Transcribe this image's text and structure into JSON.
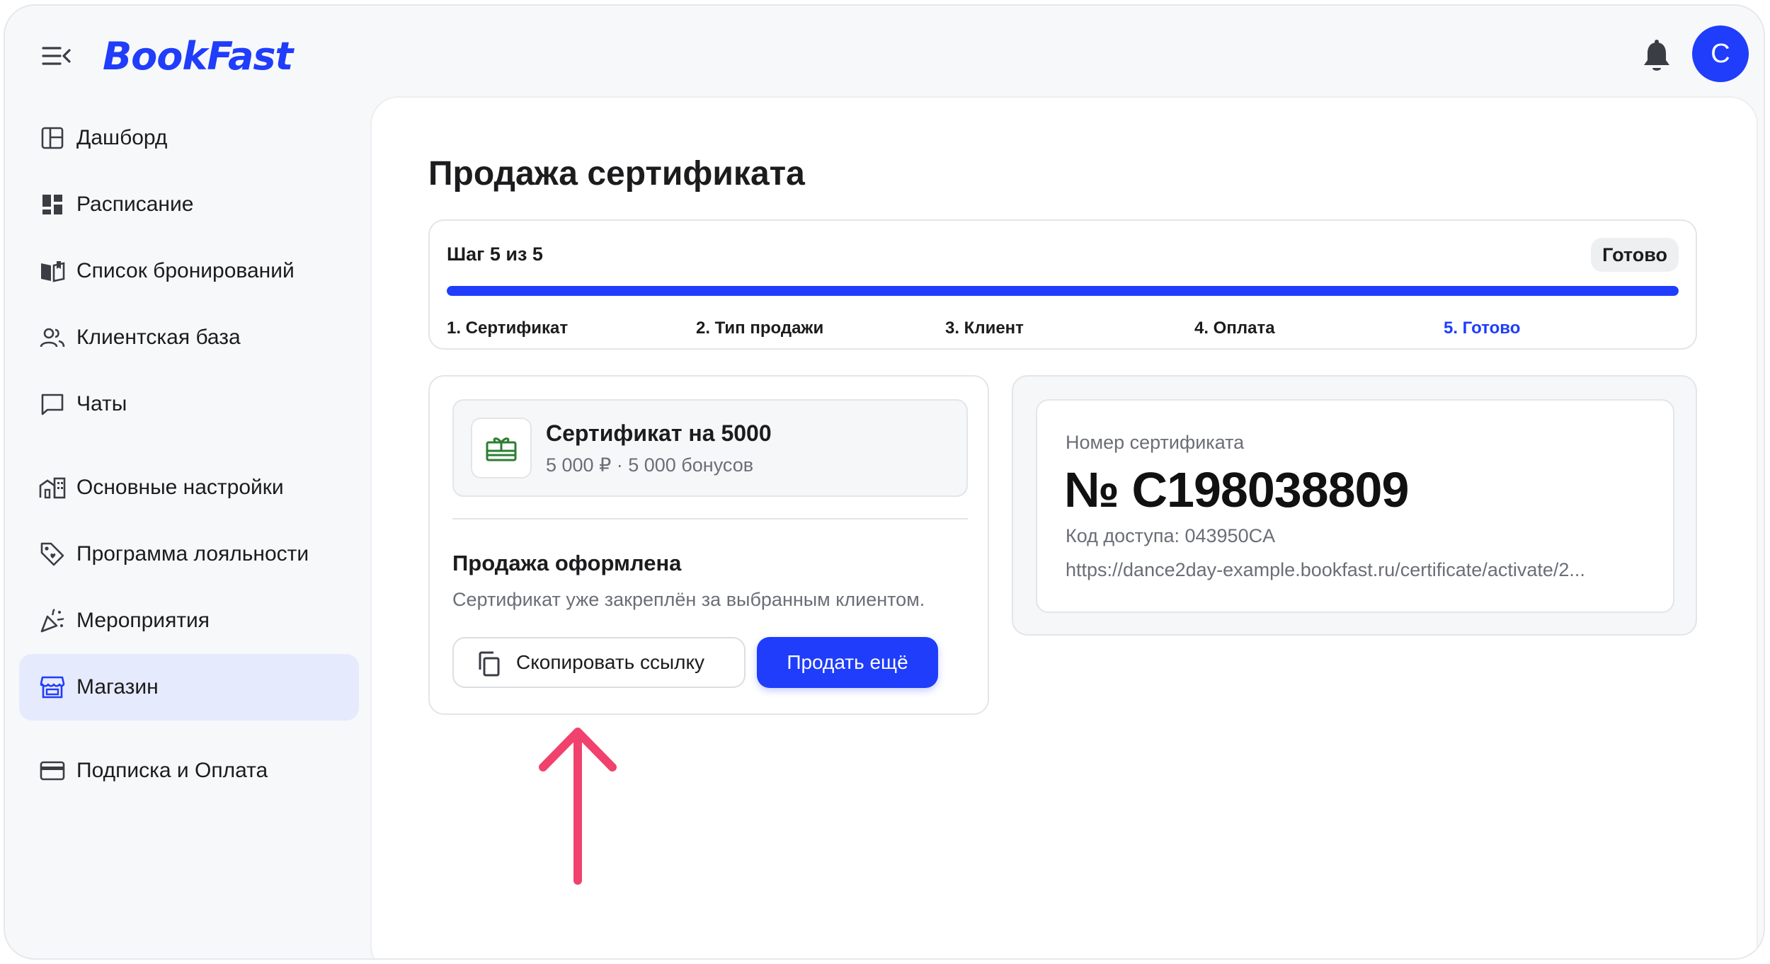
{
  "app": {
    "logo_text": "BookFast",
    "user_initial": "C"
  },
  "colors": {
    "accent": "#1f3dfa",
    "active_nav_bg": "#e6eafd",
    "annotation_arrow": "#f0426c",
    "gift_icon": "#2e7d32"
  },
  "sidebar": {
    "items": [
      {
        "label": "Дашборд",
        "icon": "dashboard-icon",
        "active": false
      },
      {
        "label": "Расписание",
        "icon": "schedule-icon",
        "active": false
      },
      {
        "label": "Список бронирований",
        "icon": "bookings-icon",
        "active": false
      },
      {
        "label": "Клиентская база",
        "icon": "clients-icon",
        "active": false
      },
      {
        "label": "Чаты",
        "icon": "chat-icon",
        "active": false
      },
      {
        "label": "Основные настройки",
        "icon": "settings-building-icon",
        "active": false
      },
      {
        "label": "Программа лояльности",
        "icon": "loyalty-tag-icon",
        "active": false
      },
      {
        "label": "Мероприятия",
        "icon": "party-popper-icon",
        "active": false
      },
      {
        "label": "Магазин",
        "icon": "store-icon",
        "active": true
      },
      {
        "label": "Подписка и Оплата",
        "icon": "credit-card-icon",
        "active": false
      }
    ]
  },
  "page": {
    "title": "Продажа сертификата"
  },
  "stepper": {
    "step_count": "Шаг 5 из 5",
    "status": "Готово",
    "progress_fraction": 1.0,
    "steps": [
      "1. Сертификат",
      "2. Тип продажи",
      "3. Клиент",
      "4. Оплата",
      "5. Готово"
    ],
    "current_step_index": 4
  },
  "certificate": {
    "title": "Сертификат на 5000",
    "subtitle": "5 000 ₽ · 5 000 бонусов",
    "icon": "gift-card-icon"
  },
  "sale": {
    "title": "Продажа оформлена",
    "description": "Сертификат уже закреплён за выбранным клиентом.",
    "copy_button": "Скопировать ссылку",
    "sell_again_button": "Продать ещё"
  },
  "certificate_info": {
    "number_label": "Номер сертификата",
    "number_value": "№ C198038809",
    "access_code": "Код доступа: 043950CA",
    "activation_url": "https://dance2day-example.bookfast.ru/certificate/activate/2..."
  }
}
